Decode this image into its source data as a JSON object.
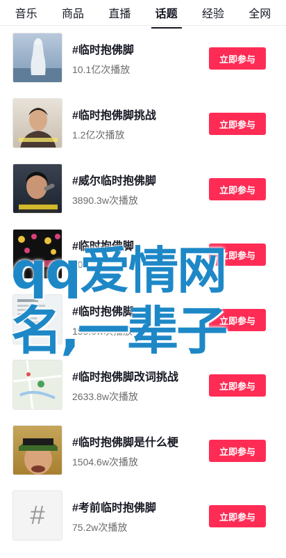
{
  "tabs": [
    {
      "label": "音乐",
      "active": false
    },
    {
      "label": "商品",
      "active": false
    },
    {
      "label": "直播",
      "active": false
    },
    {
      "label": "话题",
      "active": true
    },
    {
      "label": "经验",
      "active": false
    },
    {
      "label": "全网",
      "active": false
    }
  ],
  "items": [
    {
      "title": "#临时抱佛脚",
      "views": "10.1亿次播放",
      "button": "立即参与"
    },
    {
      "title": "#临时抱佛脚挑战",
      "views": "1.2亿次播放",
      "button": "立即参与"
    },
    {
      "title": "#威尔临时抱佛脚",
      "views": "3890.3w次播放",
      "button": "立即参与"
    },
    {
      "title": "#临时抱佛脚",
      "views": "105",
      "button": "立即参与"
    },
    {
      "title": "#临时抱佛脚",
      "views": "155.0w次播放",
      "button": "立即参与"
    },
    {
      "title": "#临时抱佛脚改词挑战",
      "views": "2633.8w次播放",
      "button": "立即参与"
    },
    {
      "title": "#临时抱佛脚是什么梗",
      "views": "1504.6w次播放",
      "button": "立即参与"
    },
    {
      "title": "#考前临时抱佛脚",
      "views": "75.2w次播放",
      "button": "立即参与"
    }
  ],
  "placeholder_thumb_glyph": "#",
  "watermark": {
    "line1": "qq爱情网",
    "line2": "名,一辈子"
  },
  "colors": {
    "accent": "#fe2c55",
    "watermark": "#1e88c7"
  }
}
